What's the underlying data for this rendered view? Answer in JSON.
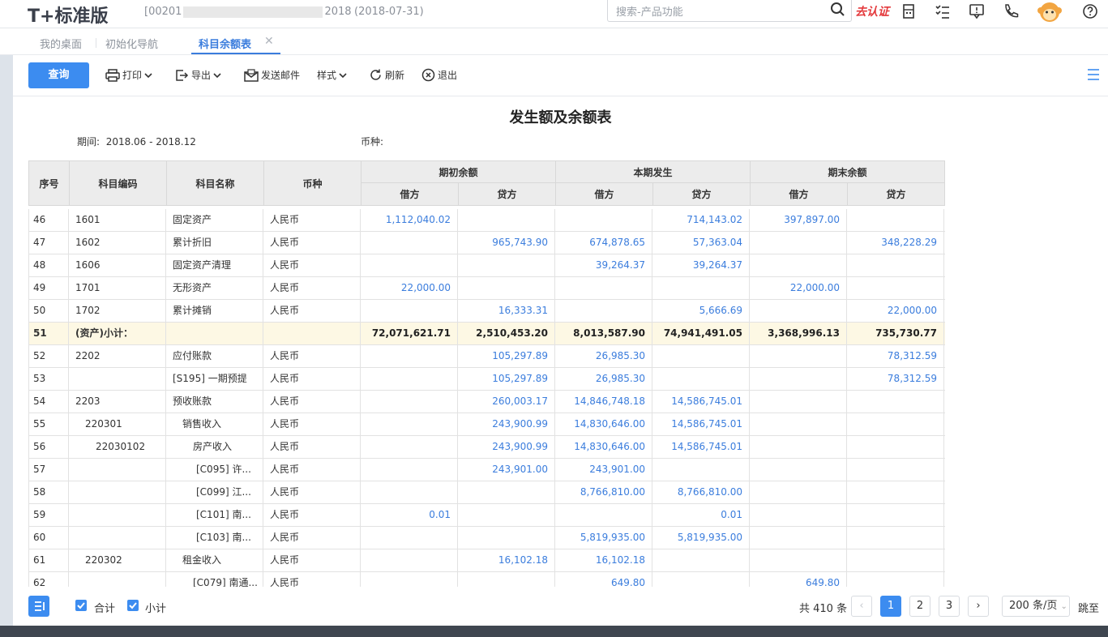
{
  "app": {
    "logo_text": "T+标准版",
    "account_prefix": "[00201",
    "account_suffix": "2018",
    "account_date": "(2018-07-31)",
    "search_placeholder": "搜索-产品功能",
    "certify_label": "去认证"
  },
  "tabs": [
    "我的桌面",
    "初始化导航",
    "科目余额表"
  ],
  "toolbar": {
    "query": "查询",
    "print": "打印",
    "export": "导出",
    "email": "发送邮件",
    "style": "样式",
    "refresh": "刷新",
    "exit": "退出"
  },
  "report": {
    "title": "发生额及余额表",
    "period_label": "期间:",
    "period_value": "2018.06 - 2018.12",
    "currency_label": "币种:"
  },
  "table": {
    "headers": {
      "seq": "序号",
      "code": "科目编码",
      "name": "科目名称",
      "currency": "币种",
      "opening": "期初余额",
      "current": "本期发生",
      "closing": "期末余额",
      "debit": "借方",
      "credit": "贷方"
    },
    "rows": [
      {
        "seq": "46",
        "code": "1601",
        "name": "固定资产",
        "cur": "人民币",
        "od": "1,112,040.02",
        "oc": "",
        "cd": "",
        "cc": "714,143.02",
        "ed": "397,897.00",
        "ec": ""
      },
      {
        "seq": "47",
        "code": "1602",
        "name": "累计折旧",
        "cur": "人民币",
        "od": "",
        "oc": "965,743.90",
        "cd": "674,878.65",
        "cc": "57,363.04",
        "ed": "",
        "ec": "348,228.29"
      },
      {
        "seq": "48",
        "code": "1606",
        "name": "固定资产清理",
        "cur": "人民币",
        "od": "",
        "oc": "",
        "cd": "39,264.37",
        "cc": "39,264.37",
        "ed": "",
        "ec": ""
      },
      {
        "seq": "49",
        "code": "1701",
        "name": "无形资产",
        "cur": "人民币",
        "od": "22,000.00",
        "oc": "",
        "cd": "",
        "cc": "",
        "ed": "22,000.00",
        "ec": ""
      },
      {
        "seq": "50",
        "code": "1702",
        "name": "累计摊销",
        "cur": "人民币",
        "od": "",
        "oc": "16,333.31",
        "cd": "",
        "cc": "5,666.69",
        "ed": "",
        "ec": "22,000.00"
      },
      {
        "seq": "51",
        "code": "(资产)小计：",
        "name": "",
        "cur": "",
        "od": "72,071,621.71",
        "oc": "2,510,453.20",
        "cd": "8,013,587.90",
        "cc": "74,941,491.05",
        "ed": "3,368,996.13",
        "ec": "735,730.77",
        "subtotal": true
      },
      {
        "seq": "52",
        "code": "2202",
        "name": "应付账款",
        "cur": "人民币",
        "od": "",
        "oc": "105,297.89",
        "cd": "26,985.30",
        "cc": "",
        "ed": "",
        "ec": "78,312.59"
      },
      {
        "seq": "53",
        "code": "",
        "name": "[S195] 一期预提",
        "cur": "人民币",
        "od": "",
        "oc": "105,297.89",
        "cd": "26,985.30",
        "cc": "",
        "ed": "",
        "ec": "78,312.59"
      },
      {
        "seq": "54",
        "code": "2203",
        "name": "预收账款",
        "cur": "人民币",
        "od": "",
        "oc": "260,003.17",
        "cd": "14,846,748.18",
        "cc": "14,586,745.01",
        "ed": "",
        "ec": ""
      },
      {
        "seq": "55",
        "code": "220301",
        "name": "销售收入",
        "cur": "人民币",
        "od": "",
        "oc": "243,900.99",
        "cd": "14,830,646.00",
        "cc": "14,586,745.01",
        "ed": "",
        "ec": "",
        "indent": 1
      },
      {
        "seq": "56",
        "code": "22030102",
        "name": "房产收入",
        "cur": "人民币",
        "od": "",
        "oc": "243,900.99",
        "cd": "14,830,646.00",
        "cc": "14,586,745.01",
        "ed": "",
        "ec": "",
        "indent": 2
      },
      {
        "seq": "57",
        "code": "",
        "name": "[C095] 许...",
        "cur": "人民币",
        "od": "",
        "oc": "243,901.00",
        "cd": "243,901.00",
        "cc": "",
        "ed": "",
        "ec": "",
        "indent": 3
      },
      {
        "seq": "58",
        "code": "",
        "name": "[C099] 江...",
        "cur": "人民币",
        "od": "",
        "oc": "",
        "cd": "8,766,810.00",
        "cc": "8,766,810.00",
        "ed": "",
        "ec": "",
        "indent": 3
      },
      {
        "seq": "59",
        "code": "",
        "name": "[C101] 南...",
        "cur": "人民币",
        "od": "0.01",
        "oc": "",
        "cd": "",
        "cc": "0.01",
        "ed": "",
        "ec": "",
        "indent": 3
      },
      {
        "seq": "60",
        "code": "",
        "name": "[C103] 南...",
        "cur": "人民币",
        "od": "",
        "oc": "",
        "cd": "5,819,935.00",
        "cc": "5,819,935.00",
        "ed": "",
        "ec": "",
        "indent": 3
      },
      {
        "seq": "61",
        "code": "220302",
        "name": "租金收入",
        "cur": "人民币",
        "od": "",
        "oc": "16,102.18",
        "cd": "16,102.18",
        "cc": "",
        "ed": "",
        "ec": "",
        "indent": 1
      },
      {
        "seq": "62",
        "code": "",
        "name": "[C079] 南通...",
        "cur": "人民币",
        "od": "",
        "oc": "",
        "cd": "649.80",
        "cc": "",
        "ed": "649.80",
        "ec": "",
        "indent": 2
      }
    ]
  },
  "footer": {
    "total_check": "合计",
    "subtotal_check": "小计",
    "total_count": "共 410 条",
    "pages": [
      "1",
      "2",
      "3"
    ],
    "page_size": "200 条/页",
    "jump": "跳至"
  }
}
